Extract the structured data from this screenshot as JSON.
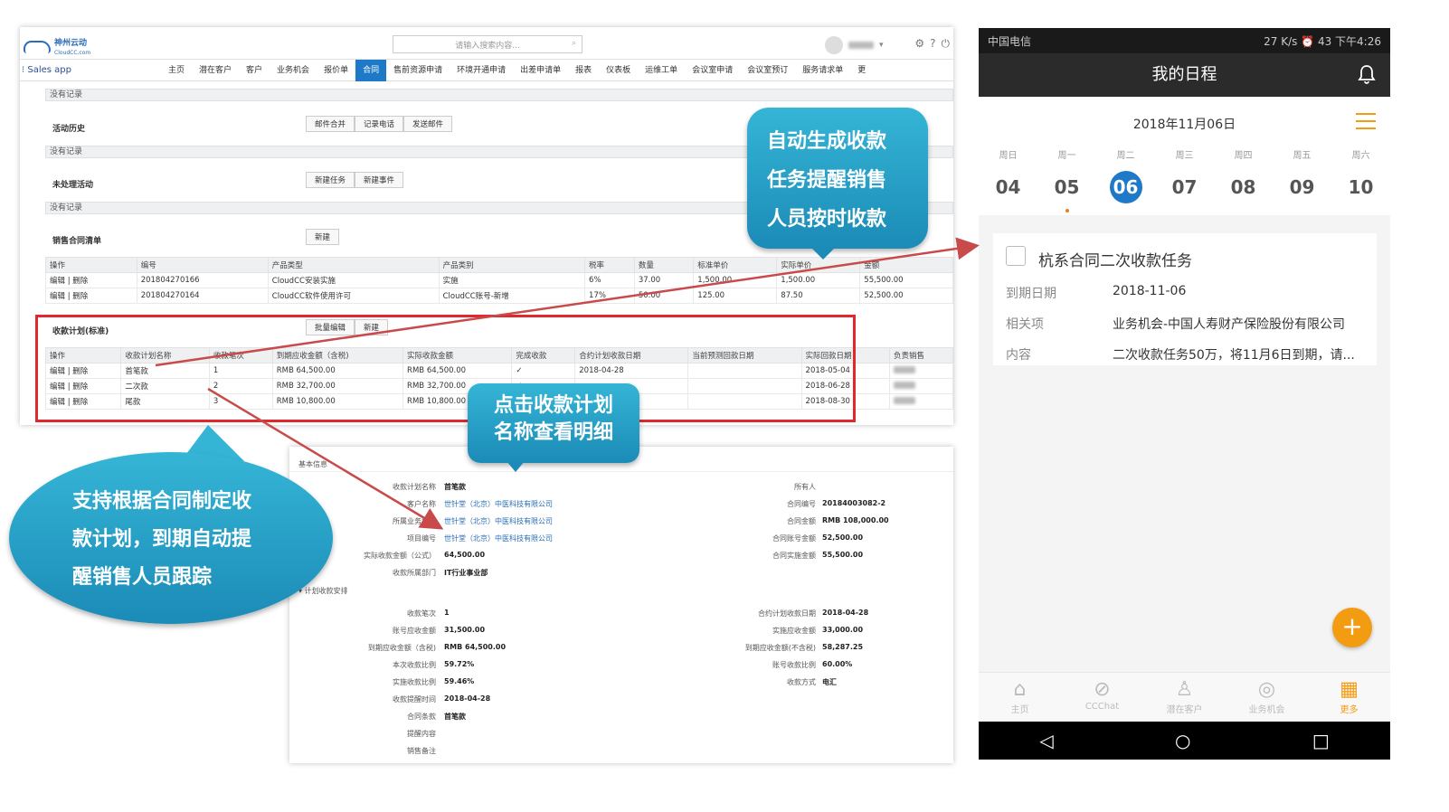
{
  "crm": {
    "logo_text": "神州云动",
    "logo_sub": "CloudCC.com",
    "search_placeholder": "请输入搜索内容...",
    "app_name": "Sales app",
    "nav": [
      "主页",
      "潜在客户",
      "客户",
      "业务机会",
      "报价单",
      "合同",
      "售前资源申请",
      "环境开通申请",
      "出差申请单",
      "报表",
      "仪表板",
      "运维工单",
      "会议室申请",
      "会议室预订",
      "服务请求单",
      "更"
    ],
    "no_record": "没有记录",
    "activity_history": "活动历史",
    "activity_btns": [
      "邮件合并",
      "记录电话",
      "发送邮件"
    ],
    "open_activities": "未处理活动",
    "open_btns": [
      "新建任务",
      "新建事件"
    ],
    "sales_contract_list": "销售合同清单",
    "new_btn": "新建",
    "product_headers": [
      "操作",
      "编号",
      "产品类型",
      "产品类别",
      "税率",
      "数量",
      "标准单价",
      "实际单价",
      "金额"
    ],
    "product_rows": [
      [
        "编辑 | 删除",
        "201804270166",
        "CloudCC安装实施",
        "实施",
        "6%",
        "37.00",
        "1,500.00",
        "1,500.00",
        "55,500.00"
      ],
      [
        "编辑 | 删除",
        "201804270164",
        "CloudCC软件使用许可",
        "CloudCC账号-新增",
        "17%",
        "50.00",
        "125.00",
        "87.50",
        "52,500.00"
      ]
    ],
    "plan_title": "收款计划(标准)",
    "plan_btns": [
      "批量编辑",
      "新建"
    ],
    "plan_headers": [
      "操作",
      "收款计划名称",
      "收款笔次",
      "到期应收金额（含税)",
      "实际收款金额",
      "完成收款",
      "合约计划收款日期",
      "当前预测回款日期",
      "实际回款日期",
      "负责销售"
    ],
    "plan_rows": [
      [
        "编辑 | 删除",
        "首笔款",
        "1",
        "RMB 64,500.00",
        "RMB 64,500.00",
        "✓",
        "2018-04-28",
        "",
        "2018-05-04"
      ],
      [
        "编辑 | 删除",
        "二次款",
        "2",
        "RMB 32,700.00",
        "RMB 32,700.00",
        "✓",
        "",
        "",
        "2018-06-28"
      ],
      [
        "编辑 | 删除",
        "尾款",
        "3",
        "RMB 10,800.00",
        "RMB 10,800.00",
        "",
        "",
        "",
        "2018-08-30"
      ]
    ]
  },
  "detail": {
    "section_basic": "基本信息",
    "left": [
      {
        "label": "收款计划名称",
        "value": "首笔款"
      },
      {
        "label": "客户名称",
        "value": "世针堂（北京）中医科技有限公司"
      },
      {
        "label": "所属业务机会",
        "value": "世针堂（北京）中医科技有限公司"
      },
      {
        "label": "项目编号",
        "value": "世针堂（北京）中医科技有限公司"
      },
      {
        "label": "实际收款金额（公式）",
        "value": "64,500.00"
      },
      {
        "label": "收款所属部门",
        "value": "IT行业事业部"
      }
    ],
    "right": [
      {
        "label": "所有人",
        "value": ""
      },
      {
        "label": "合同编号",
        "value": "20184003082-2"
      },
      {
        "label": "合同金额",
        "value": "RMB 108,000.00"
      },
      {
        "label": "合同账号金额",
        "value": "52,500.00"
      },
      {
        "label": "合同实施金额",
        "value": "55,500.00"
      }
    ],
    "section_plan": "▾ 计划收款安排",
    "left2": [
      {
        "label": "收款笔次",
        "value": "1"
      },
      {
        "label": "账号应收金额",
        "value": "31,500.00"
      },
      {
        "label": "到期应收金额（含税)",
        "value": "RMB 64,500.00"
      },
      {
        "label": "本次收款比例",
        "value": "59.72%"
      },
      {
        "label": "实施收款比例",
        "value": "59.46%"
      },
      {
        "label": "收款提醒时间",
        "value": "2018-04-28"
      },
      {
        "label": "合同条款",
        "value": "首笔款"
      },
      {
        "label": "提醒内容",
        "value": ""
      },
      {
        "label": "销售备注",
        "value": ""
      }
    ],
    "right2": [
      {
        "label": "合约计划收款日期",
        "value": "2018-04-28"
      },
      {
        "label": "实施应收金额",
        "value": "33,000.00"
      },
      {
        "label": "到期应收金额(不含税)",
        "value": "58,287.25"
      },
      {
        "label": "账号收款比例",
        "value": "60.00%"
      },
      {
        "label": "收款方式",
        "value": "电汇"
      }
    ]
  },
  "phone": {
    "carrier": "中国电信",
    "status_right": "27 K/s  ⏰ 43  下午4:26",
    "title": "我的日程",
    "date": "2018年11月06日",
    "weekdays": [
      "周日",
      "周一",
      "周二",
      "周三",
      "周四",
      "周五",
      "周六"
    ],
    "days": [
      "04",
      "05",
      "06",
      "07",
      "08",
      "09",
      "10"
    ],
    "task_title": "杭系合同二次收款任务",
    "due_label": "到期日期",
    "due_value": "2018-11-06",
    "related_label": "相关项",
    "related_value": "业务机会-中国人寿财产保险股份有限公司",
    "content_label": "内容",
    "content_value": "二次收款任务50万，将11月6日到期，请...",
    "tabs": [
      "主页",
      "CCChat",
      "潜在客户",
      "业务机会",
      "更多"
    ]
  },
  "callouts": {
    "auto": [
      "自动生成收款",
      "任务提醒销售",
      "人员按时收款"
    ],
    "click": [
      "点击收款计划",
      "名称查看明细"
    ],
    "plan": [
      "支持根据合同制定收",
      "款计划，到期自动提",
      "醒销售人员跟踪"
    ]
  },
  "colors": {
    "accent": "#1e79c8",
    "highlight": "#e0282d",
    "callout": "#2aa3c9",
    "orange": "#f39c12"
  }
}
